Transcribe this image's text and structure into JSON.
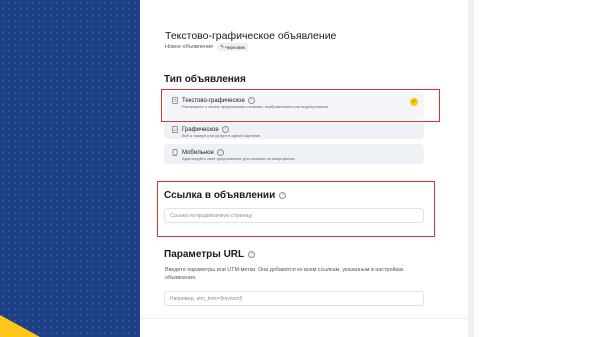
{
  "header": {
    "title": "Текстово-графическое объявление",
    "subtitle": "Новое объявление",
    "badge": "Черновик"
  },
  "ad_type": {
    "heading": "Тип объявления",
    "options": [
      {
        "title": "Текстово-графическое",
        "description": "Расскажите о своём предложении словами, изображением или видеороликом",
        "selected": true
      },
      {
        "title": "Графическое",
        "description": "Всё о товаре или услуге в одной картинке",
        "selected": false
      },
      {
        "title": "Мобильное",
        "description": "Адаптируйте своё предложение для показов на смартфонах",
        "selected": false
      }
    ]
  },
  "link": {
    "heading": "Ссылка в объявлении",
    "placeholder": "Ссылка на продвигаемую страницу",
    "value": ""
  },
  "url_params": {
    "heading": "Параметры URL",
    "description": "Введите параметры или UTM-метки. Они добавятся ко всем ссылкам, указанным в настройках объявления.",
    "placeholder": "Например, utm_term={keyword}",
    "value": ""
  },
  "colors": {
    "background_blue": "#1d3f86",
    "accent_yellow": "#ffcc00",
    "highlight_red": "#e0322b"
  }
}
